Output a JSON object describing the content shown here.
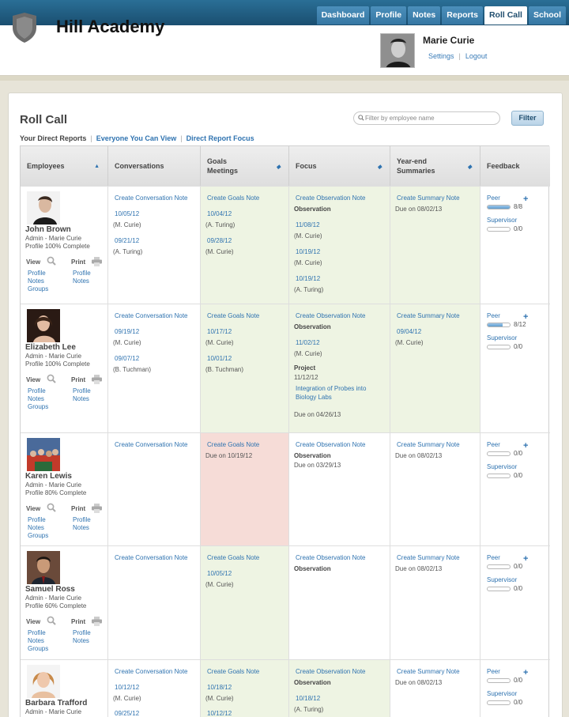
{
  "nav": {
    "tabs": [
      {
        "label": "Dashboard",
        "active": false
      },
      {
        "label": "Profile",
        "active": false
      },
      {
        "label": "Notes",
        "active": false
      },
      {
        "label": "Reports",
        "active": false
      },
      {
        "label": "Roll Call",
        "active": true
      },
      {
        "label": "School",
        "active": false
      }
    ]
  },
  "header": {
    "school_name": "Hill Academy",
    "user_name": "Marie Curie",
    "settings": "Settings",
    "logout": "Logout"
  },
  "page": {
    "title": "Roll Call",
    "search_placeholder": "Filter by employee name",
    "filter_button": "Filter",
    "subnav": {
      "current": "Your Direct Reports",
      "link1": "Everyone You Can View",
      "link2": "Direct Report Focus"
    }
  },
  "table": {
    "headers": {
      "employees": "Employees",
      "conversations": "Conversations",
      "goals": "Goals Meetings",
      "focus": "Focus",
      "summaries": "Year-end Summaries",
      "feedback": "Feedback"
    },
    "labels": {
      "create_conv": "Create Conversation Note",
      "create_goals": "Create Goals Note",
      "create_obs": "Create Observation Note",
      "create_summary": "Create Summary Note",
      "observation": "Observation",
      "project": "Project",
      "view": "View",
      "print": "Print",
      "profile": "Profile",
      "notes": "Notes",
      "groups": "Groups",
      "peer": "Peer",
      "supervisor": "Supervisor"
    },
    "rows": [
      {
        "name": "John Brown",
        "role": "Admin - Marie Curie",
        "profile": "Profile 100% Complete",
        "conv": [
          {
            "date": "10/05/12",
            "by": "(M. Curie)"
          },
          {
            "date": "09/21/12",
            "by": "(A. Turing)"
          }
        ],
        "goals": [
          {
            "date": "10/04/12",
            "by": "(A. Turing)"
          },
          {
            "date": "09/28/12",
            "by": "(M. Curie)"
          }
        ],
        "focus": [
          {
            "date": "11/08/12",
            "by": "(M. Curie)"
          },
          {
            "date": "10/19/12",
            "by": "(M. Curie)"
          },
          {
            "date": "10/19/12",
            "by": "(A. Turing)"
          }
        ],
        "summary_due": "Due on 08/02/13",
        "peer": "8/8",
        "peer_fraction": 1.0,
        "supervisor": "0/0",
        "supervisor_fraction": 0
      },
      {
        "name": "Elizabeth Lee",
        "role": "Admin - Marie Curie",
        "profile": "Profile 100% Complete",
        "conv": [
          {
            "date": "09/19/12",
            "by": "(M. Curie)"
          },
          {
            "date": "09/07/12",
            "by": "(B. Tuchman)"
          }
        ],
        "goals": [
          {
            "date": "10/17/12",
            "by": "(M. Curie)"
          },
          {
            "date": "10/01/12",
            "by": "(B. Tuchman)"
          }
        ],
        "focus": [
          {
            "date": "11/02/12",
            "by": "(M. Curie)"
          }
        ],
        "project_date": "11/12/12",
        "project_title_1": "Integration of Probes into",
        "project_title_2": "Biology Labs",
        "project_due": "Due on 04/26/13",
        "summary": {
          "date": "09/04/12",
          "by": "(M. Curie)"
        },
        "peer": "8/12",
        "peer_fraction": 0.67,
        "supervisor": "0/0",
        "supervisor_fraction": 0
      },
      {
        "name": "Karen Lewis",
        "role": "Admin - Marie Curie",
        "profile": "Profile 80% Complete",
        "goals_due": "Due on 10/19/12",
        "focus_due": "Due on 03/29/13",
        "summary_due": "Due on 08/02/13",
        "peer": "0/0",
        "peer_fraction": 0,
        "supervisor": "0/0",
        "supervisor_fraction": 0
      },
      {
        "name": "Samuel Ross",
        "role": "Admin - Marie Curie",
        "profile": "Profile 60% Complete",
        "goals": [
          {
            "date": "10/05/12",
            "by": "(M. Curie)"
          }
        ],
        "summary_due": "Due on 08/02/13",
        "peer": "0/0",
        "peer_fraction": 0,
        "supervisor": "0/0",
        "supervisor_fraction": 0
      },
      {
        "name": "Barbara Trafford",
        "role": "Admin - Marie Curie",
        "conv": [
          {
            "date": "10/12/12",
            "by": "(M. Curie)"
          },
          {
            "date": "09/25/12",
            "by": ""
          }
        ],
        "goals": [
          {
            "date": "10/18/12",
            "by": "(M. Curie)"
          },
          {
            "date": "10/12/12",
            "by": ""
          }
        ],
        "focus": [
          {
            "date": "10/18/12",
            "by": "(A. Turing)"
          }
        ],
        "summary_due": "Due on 08/02/13",
        "peer": "0/0",
        "peer_fraction": 0,
        "supervisor": "0/0",
        "supervisor_fraction": 0
      }
    ]
  }
}
